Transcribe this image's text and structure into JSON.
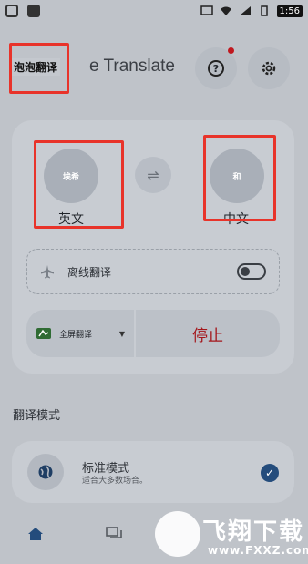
{
  "status_bar": {
    "time": "1:56"
  },
  "header": {
    "title_partial": "e Translate",
    "title_overlay": "泡泡翻译"
  },
  "languages": {
    "source_circle_text": "埃希",
    "source_label": "英文",
    "target_circle_text": "和",
    "target_label": "中文"
  },
  "offline": {
    "label": "离线翻译",
    "enabled": false
  },
  "controls": {
    "mode_label": "全屏翻译",
    "stop_label": "停止"
  },
  "section": {
    "title": "翻译模式"
  },
  "mode_card": {
    "title": "标准模式",
    "subtitle": "适合大多数场合。",
    "selected": true
  },
  "watermark": {
    "text": "飞翔下载",
    "url": "www.FXXZ.com"
  },
  "colors": {
    "accent": "#244c7c",
    "stop": "#a4161b",
    "annotation": "#e8332a"
  }
}
